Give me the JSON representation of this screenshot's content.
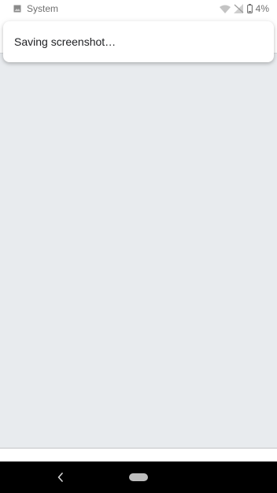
{
  "status_bar": {
    "notification_label": "System",
    "battery_percent": "4%",
    "icons": [
      "image-notification-icon",
      "wifi-icon",
      "no-signal-icon",
      "battery-low-icon"
    ]
  },
  "toast": {
    "message": "Saving screenshot…"
  },
  "navigation": {
    "icons": [
      "back-icon",
      "home-pill-icon"
    ]
  },
  "colors": {
    "background": "#e8ebee",
    "surface": "#ffffff",
    "nav_bar": "#000000",
    "status_text": "#6f6f6f"
  }
}
